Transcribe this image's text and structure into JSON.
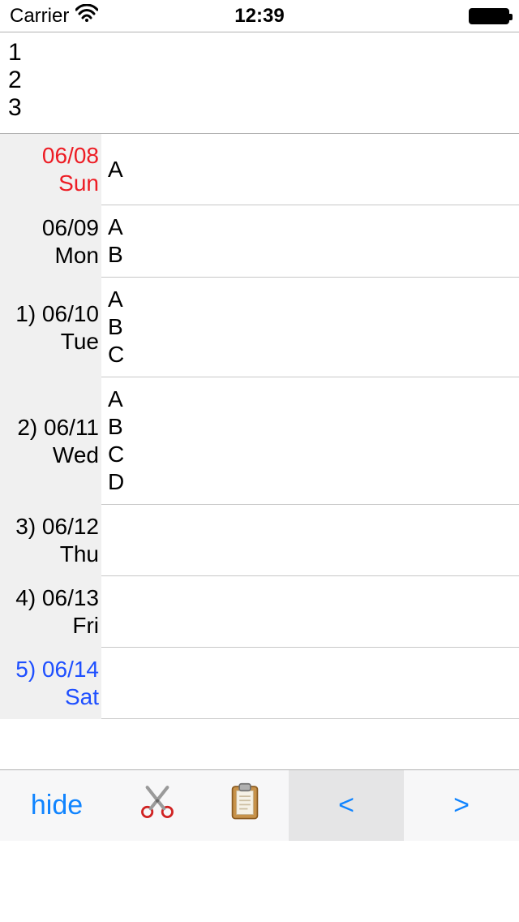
{
  "status": {
    "carrier": "Carrier",
    "time": "12:39"
  },
  "header": {
    "line1": "1",
    "line2": "2",
    "line3": "3"
  },
  "rows": [
    {
      "prefix": "",
      "date": "06/08",
      "dow": "Sun",
      "color": "red",
      "entries": [
        "A"
      ]
    },
    {
      "prefix": "",
      "date": "06/09",
      "dow": "Mon",
      "color": "",
      "entries": [
        "A",
        "B"
      ]
    },
    {
      "prefix": "1) ",
      "date": "06/10",
      "dow": "Tue",
      "color": "",
      "entries": [
        "A",
        "B",
        "C"
      ]
    },
    {
      "prefix": "2) ",
      "date": "06/11",
      "dow": "Wed",
      "color": "",
      "entries": [
        "A",
        "B",
        "C",
        "D"
      ]
    },
    {
      "prefix": "3) ",
      "date": "06/12",
      "dow": "Thu",
      "color": "",
      "entries": []
    },
    {
      "prefix": "4) ",
      "date": "06/13",
      "dow": "Fri",
      "color": "",
      "entries": []
    },
    {
      "prefix": "5) ",
      "date": "06/14",
      "dow": "Sat",
      "color": "blue",
      "entries": []
    }
  ],
  "toolbar": {
    "hide_label": "hide",
    "prev_label": "<",
    "next_label": ">"
  },
  "icons": {
    "scissors": "scissors-icon",
    "clipboard": "clipboard-icon",
    "wifi": "wifi-icon",
    "battery": "battery-icon"
  }
}
